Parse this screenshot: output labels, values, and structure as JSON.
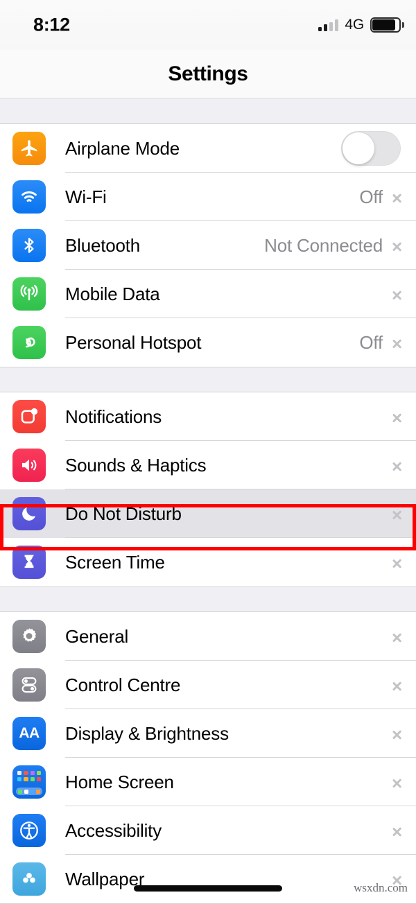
{
  "status_bar": {
    "time": "8:12",
    "network_label": "4G",
    "signal_bars_filled": 2,
    "signal_bars_total": 4,
    "battery_icon": "battery-icon"
  },
  "nav": {
    "title": "Settings"
  },
  "colors": {
    "page_background": "#efeff4",
    "row_background": "#ffffff",
    "pressed_row": "#e2e2e7",
    "separator": "#d6d6d9",
    "value_text": "#8b8b90",
    "annotation": "#ff0000",
    "orange": "#fca311",
    "blue": "#0a74ef",
    "green": "#2fc14b",
    "red": "#f23b33",
    "pink": "#fb3b5c",
    "purple": "#5856d6",
    "gray": "#8e8e93"
  },
  "groups": [
    {
      "id": "connectivity",
      "rows": [
        {
          "label": "Airplane Mode",
          "icon": "airplane-icon",
          "accessory": "toggle",
          "toggle_on": false,
          "value": ""
        },
        {
          "label": "Wi-Fi",
          "icon": "wifi-icon",
          "accessory": "chevron",
          "value": "Off"
        },
        {
          "label": "Bluetooth",
          "icon": "bluetooth-icon",
          "accessory": "chevron",
          "value": "Not Connected"
        },
        {
          "label": "Mobile Data",
          "icon": "mobile-data-icon",
          "accessory": "chevron",
          "value": ""
        },
        {
          "label": "Personal Hotspot",
          "icon": "personal-hotspot-icon",
          "accessory": "chevron",
          "value": "Off"
        }
      ]
    },
    {
      "id": "alerts",
      "rows": [
        {
          "label": "Notifications",
          "icon": "notifications-icon",
          "accessory": "chevron",
          "value": ""
        },
        {
          "label": "Sounds & Haptics",
          "icon": "sounds-icon",
          "accessory": "chevron",
          "value": ""
        },
        {
          "label": "Do Not Disturb",
          "icon": "do-not-disturb-icon",
          "accessory": "chevron",
          "value": "",
          "highlighted": true
        },
        {
          "label": "Screen Time",
          "icon": "screen-time-icon",
          "accessory": "chevron",
          "value": ""
        }
      ]
    },
    {
      "id": "system",
      "rows": [
        {
          "label": "General",
          "icon": "general-gear-icon",
          "accessory": "chevron",
          "value": ""
        },
        {
          "label": "Control Centre",
          "icon": "control-centre-icon",
          "accessory": "chevron",
          "value": ""
        },
        {
          "label": "Display & Brightness",
          "icon": "display-brightness-icon",
          "accessory": "chevron",
          "value": ""
        },
        {
          "label": "Home Screen",
          "icon": "home-screen-icon",
          "accessory": "chevron",
          "value": ""
        },
        {
          "label": "Accessibility",
          "icon": "accessibility-icon",
          "accessory": "chevron",
          "value": ""
        },
        {
          "label": "Wallpaper",
          "icon": "wallpaper-icon",
          "accessory": "chevron",
          "value": "",
          "clipped": true
        }
      ]
    }
  ],
  "annotation": {
    "target_row": "Do Not Disturb",
    "color": "#ff0000"
  },
  "watermark": {
    "text": "wsxdn.com"
  },
  "home_indicator": {
    "name": "home-indicator"
  }
}
